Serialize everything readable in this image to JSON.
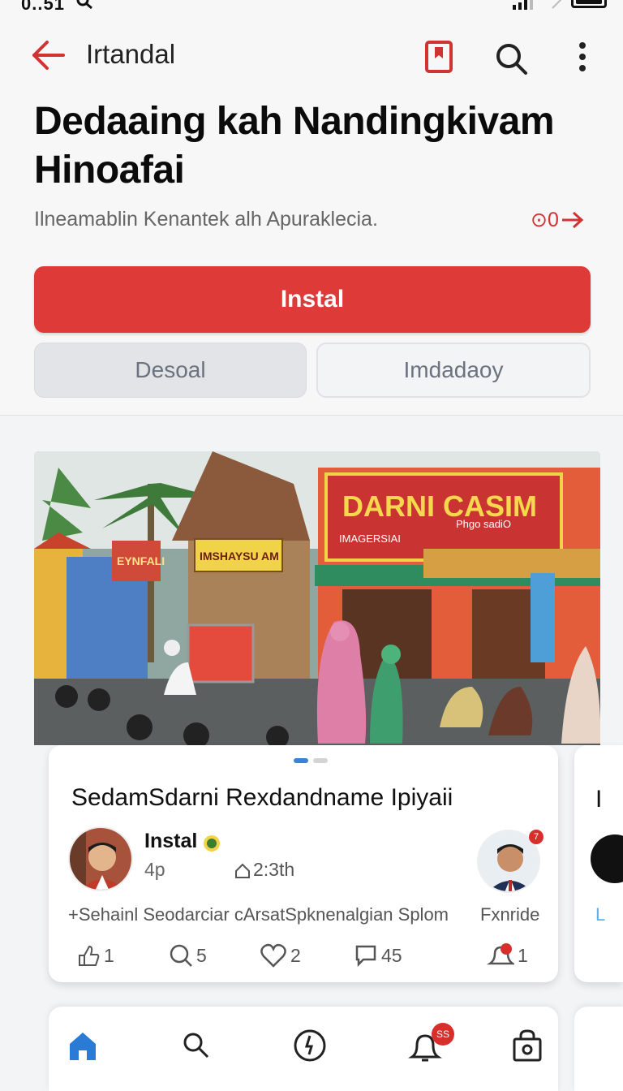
{
  "status_bar": {
    "time": "0..51"
  },
  "header": {
    "app_title": "Irtandal",
    "page_title": "Dedaaing kah Nandingkivam Hinoafai",
    "subtitle": "Ilneamablin Kenantek alh Apuraklecia.",
    "subtitle_link": "⊙0"
  },
  "buttons": {
    "primary": "Instal",
    "secondary_left": "Desoal",
    "secondary_right": "Imdadaoy"
  },
  "hero": {
    "sign_main": "DARNI CASIM",
    "sign_sub_left": "IMAGERSIAI",
    "sign_sub_right": "Phgo sadiO",
    "sign_small": "IMSHAYSU AM",
    "sign_left": "EYNFALI"
  },
  "post": {
    "carousel_active": 0,
    "carousel_count": 2,
    "title": "SedamSdarni Rexdandname Ipiyaii",
    "author": "Instal",
    "age": "4p",
    "shares": "2:3th",
    "caption": "+Sehainl Seodarciar cArsatSpknenalgian Splom",
    "caption_right": "Fxnride",
    "badge": "7",
    "actions": {
      "likes": "1",
      "comments": "5",
      "hearts": "2",
      "replies": "45",
      "alerts": "1"
    }
  },
  "side_card": {
    "letter": "I",
    "link": "L"
  },
  "tabbar": {
    "notification_badge": "SS"
  },
  "colors": {
    "accent": "#de3a38",
    "active_tab": "#2a7bd6"
  }
}
